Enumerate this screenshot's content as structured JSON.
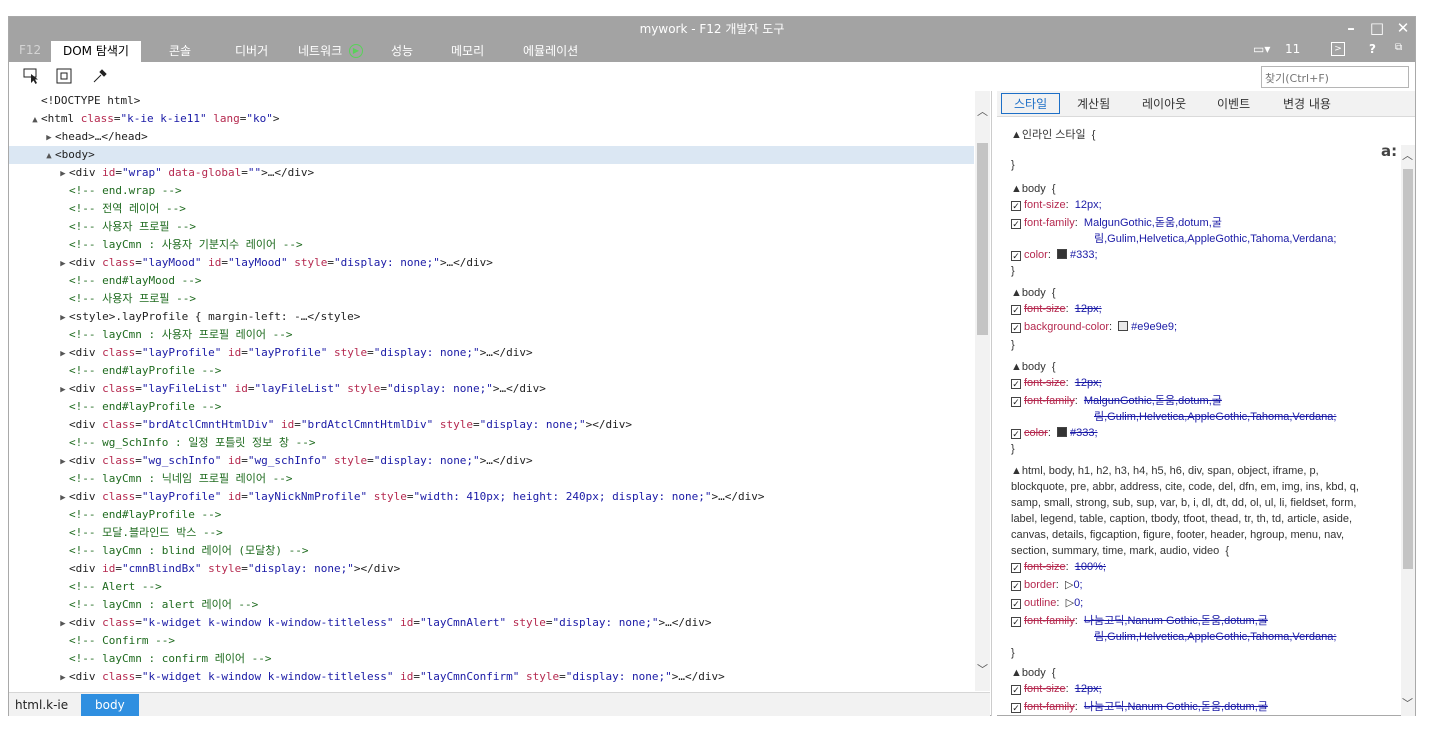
{
  "window": {
    "title": "mywork - F12 개발자 도구"
  },
  "tabs": {
    "f12": "F12",
    "items": [
      "DOM 탐색기",
      "콘솔",
      "디버거",
      "네트워크",
      "성능",
      "메모리",
      "에뮬레이션"
    ],
    "emulation_count": "11",
    "help": "?"
  },
  "find": {
    "placeholder": "찾기(Ctrl+F)"
  },
  "dom_lines": [
    {
      "t": "<!DOCTYPE html>",
      "c": "tg"
    },
    {
      "t": "<html class=\"k-ie k-ie11\" lang=\"ko\">",
      "c": "tg"
    },
    {
      "t": "<head>…</head>",
      "c": "tg"
    },
    {
      "t": "<body>",
      "c": "tg"
    },
    {
      "t": "<div id=\"wrap\" data-global=\"\">…</div>",
      "c": "tg"
    },
    {
      "t": "<!-- end.wrap -->",
      "c": "cm"
    },
    {
      "t": "<!-- 전역 레이어 -->",
      "c": "cm"
    },
    {
      "t": "<!-- 사용자 프로필 -->",
      "c": "cm"
    },
    {
      "t": "<!-- layCmn : 사용자 기분지수 레이어 -->",
      "c": "cm"
    },
    {
      "t": "<div class=\"layMood\" id=\"layMood\" style=\"display: none;\">…</div>",
      "c": "tg"
    },
    {
      "t": "<!-- end#layMood -->",
      "c": "cm"
    },
    {
      "t": "<!-- 사용자 프로필 -->",
      "c": "cm"
    },
    {
      "t": "<style>.layProfile { margin-left: -…</style>",
      "c": "tg"
    },
    {
      "t": "<!-- layCmn : 사용자 프로필 레이어 -->",
      "c": "cm"
    },
    {
      "t": "<div class=\"layProfile\" id=\"layProfile\" style=\"display: none;\">…</div>",
      "c": "tg"
    },
    {
      "t": "<!-- end#layProfile -->",
      "c": "cm"
    },
    {
      "t": "<div class=\"layFileList\" id=\"layFileList\" style=\"display: none;\">…</div>",
      "c": "tg"
    },
    {
      "t": "<!-- end#layProfile -->",
      "c": "cm"
    },
    {
      "t": "<div class=\"brdAtclCmntHtmlDiv\" id=\"brdAtclCmntHtmlDiv\" style=\"display: none;\"></div>",
      "c": "tg"
    },
    {
      "t": "<!-- wg_SchInfo : 일정 포틀릿 정보 창 -->",
      "c": "cm"
    },
    {
      "t": "<div class=\"wg_schInfo\" id=\"wg_schInfo\" style=\"display: none;\">…</div>",
      "c": "tg"
    },
    {
      "t": "<!-- layCmn : 닉네임 프로필 레이어 -->",
      "c": "cm"
    },
    {
      "t": "<div class=\"layProfile\" id=\"layNickNmProfile\" style=\"width: 410px; height: 240px; display: none;\">…</div>",
      "c": "tg"
    },
    {
      "t": "<!-- end#layProfile -->",
      "c": "cm"
    },
    {
      "t": "<!-- 모달.블라인드 박스 -->",
      "c": "cm"
    },
    {
      "t": "<!-- layCmn : blind 레이어 (모달창) -->",
      "c": "cm"
    },
    {
      "t": "<div id=\"cmnBlindBx\" style=\"display: none;\"></div>",
      "c": "tg"
    },
    {
      "t": "<!-- Alert -->",
      "c": "cm"
    },
    {
      "t": "<!-- layCmn : alert 레이어 -->",
      "c": "cm"
    },
    {
      "t": "<div class=\"k-widget k-window k-window-titleless\" id=\"layCmnAlert\" style=\"display: none;\">…</div>",
      "c": "tg"
    },
    {
      "t": "<!-- Confirm -->",
      "c": "cm"
    },
    {
      "t": "<!-- layCmn : confirm 레이어 -->",
      "c": "cm"
    },
    {
      "t": "<div class=\"k-widget k-window k-window-titleless\" id=\"layCmnConfirm\" style=\"display: none;\">…</div>",
      "c": "tg"
    }
  ],
  "breadcrumb": {
    "items": [
      "html.k-ie",
      "body"
    ]
  },
  "right_tabs": [
    "스타일",
    "계산됨",
    "레이아웃",
    "이벤트",
    "변경 내용"
  ],
  "styles": {
    "inline_header": "인라인 스타일  {",
    "close": "}",
    "aa": "a:",
    "body": "body  {",
    "r1": [
      {
        "n": "font-size",
        "v": "12px;"
      },
      {
        "n": "font-family",
        "v": "MalgunGothic,돋움,dotum,굴"
      },
      {
        "v2": "림,Gulim,Helvetica,AppleGothic,Tahoma,Verdana;"
      },
      {
        "n": "color",
        "v": "#333;"
      }
    ],
    "r2": [
      {
        "n": "font-size",
        "v": "12px;"
      },
      {
        "n": "background-color",
        "v": "#e9e9e9;"
      }
    ],
    "r3": [
      {
        "n": "font-size",
        "v": "12px;"
      },
      {
        "n": "font-family",
        "v": "MalgunGothic,돋움,dotum,굴"
      },
      {
        "v2": "림,Gulim,Helvetica,AppleGothic,Tahoma,Verdana;"
      },
      {
        "n": "color",
        "v": "#333;"
      }
    ],
    "reset_sel": [
      "html, body, h1, h2, h3, h4, h5, h6, div, span, object, iframe, p,",
      "blockquote, pre, abbr, address, cite, code, del, dfn, em, img, ins, kbd, q,",
      "samp, small, strong, sub, sup, var, b, i, dl, dt, dd, ol, ul, li, fieldset, form,",
      "label, legend, table, caption, tbody, tfoot, thead, tr, th, td, article, aside,",
      "canvas, details, figcaption, figure, footer, header, hgroup, menu, nav,",
      "section, summary, time, mark, audio, video  {"
    ],
    "r4": [
      {
        "n": "font-size",
        "v": "100%;"
      },
      {
        "n": "border",
        "v": "0;"
      },
      {
        "n": "outline",
        "v": "0;"
      },
      {
        "n": "font-family",
        "v": "나눔고딕,Nanum Gothic,돋움,dotum,굴"
      },
      {
        "v2": "림,Gulim,Helvetica,AppleGothic,Tahoma,Verdana;"
      }
    ],
    "r5": [
      {
        "n": "font-size",
        "v": "12px;"
      },
      {
        "n": "font-family",
        "v": "나눔고딕,Nanum Gothic,돋움,dotum,굴"
      }
    ]
  },
  "colors": {
    "swatch_333": "#333333",
    "swatch_e9": "#e9e9e9",
    "accent": "#2f8fe0"
  }
}
